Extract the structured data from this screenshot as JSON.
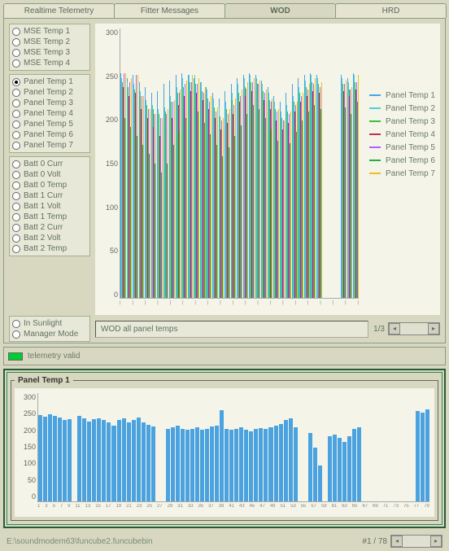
{
  "tabs": [
    {
      "label": "Realtime Telemetry",
      "active": false
    },
    {
      "label": "Fitter Messages",
      "active": false
    },
    {
      "label": "WOD",
      "active": true
    },
    {
      "label": "HRD",
      "active": false
    }
  ],
  "sidebar": {
    "group1": [
      {
        "label": "MSE Temp 1",
        "selected": false
      },
      {
        "label": "MSE Temp 2",
        "selected": false
      },
      {
        "label": "MSE Temp 3",
        "selected": false
      },
      {
        "label": "MSE Temp 4",
        "selected": false
      }
    ],
    "group2": [
      {
        "label": "Panel Temp 1",
        "selected": true
      },
      {
        "label": "Panel Temp 2",
        "selected": false
      },
      {
        "label": "Panel Temp 3",
        "selected": false
      },
      {
        "label": "Panel Temp 4",
        "selected": false
      },
      {
        "label": "Panel Temp 5",
        "selected": false
      },
      {
        "label": "Panel Temp 6",
        "selected": false
      },
      {
        "label": "Panel Temp 7",
        "selected": false
      }
    ],
    "group3": [
      {
        "label": "Batt 0 Curr",
        "selected": false
      },
      {
        "label": "Batt 0 Volt",
        "selected": false
      },
      {
        "label": "Batt 0 Temp",
        "selected": false
      },
      {
        "label": "Batt 1 Curr",
        "selected": false
      },
      {
        "label": "Batt 1 Volt",
        "selected": false
      },
      {
        "label": "Batt 1 Temp",
        "selected": false
      },
      {
        "label": "Batt 2 Curr",
        "selected": false
      },
      {
        "label": "Batt 2 Volt",
        "selected": false
      },
      {
        "label": "Batt 2 Temp",
        "selected": false
      }
    ],
    "group4": [
      {
        "label": "In Sunlight",
        "selected": false
      },
      {
        "label": "Manager Mode",
        "selected": false
      }
    ]
  },
  "chart_data": [
    {
      "type": "bar",
      "title": "",
      "ylim": [
        0,
        300
      ],
      "yticks": [
        0,
        50,
        100,
        150,
        200,
        250,
        300
      ],
      "series": [
        {
          "name": "Panel Temp 1",
          "color": "#4aa3e0"
        },
        {
          "name": "Panel Temp 2",
          "color": "#4ad0e0"
        },
        {
          "name": "Panel Temp 3",
          "color": "#3ac040"
        },
        {
          "name": "Panel Temp 4",
          "color": "#c03050"
        },
        {
          "name": "Panel Temp 5",
          "color": "#b060ff"
        },
        {
          "name": "Panel Temp 6",
          "color": "#20b040"
        },
        {
          "name": "Panel Temp 7",
          "color": "#e8c020"
        }
      ],
      "columns": [
        [
          250,
          245,
          240,
          235,
          250,
          200,
          250
        ],
        [
          245,
          240,
          235,
          225,
          240,
          190,
          245
        ],
        [
          248,
          238,
          232,
          228,
          248,
          180,
          248
        ],
        [
          240,
          230,
          225,
          210,
          225,
          170,
          225
        ],
        [
          235,
          220,
          215,
          200,
          210,
          160,
          210
        ],
        [
          228,
          215,
          210,
          190,
          205,
          150,
          205
        ],
        [
          230,
          210,
          205,
          180,
          200,
          140,
          200
        ],
        [
          238,
          212,
          208,
          185,
          205,
          150,
          210
        ],
        [
          242,
          225,
          218,
          200,
          218,
          170,
          220
        ],
        [
          248,
          235,
          228,
          215,
          228,
          185,
          232
        ],
        [
          250,
          245,
          235,
          225,
          238,
          200,
          242
        ],
        [
          248,
          248,
          240,
          230,
          240,
          210,
          248
        ],
        [
          245,
          248,
          238,
          228,
          238,
          208,
          245
        ],
        [
          240,
          240,
          230,
          220,
          228,
          195,
          235
        ],
        [
          235,
          232,
          222,
          210,
          218,
          182,
          225
        ],
        [
          228,
          222,
          212,
          200,
          208,
          170,
          212
        ],
        [
          222,
          212,
          202,
          188,
          198,
          158,
          200
        ],
        [
          230,
          218,
          210,
          195,
          205,
          168,
          210
        ],
        [
          238,
          228,
          220,
          205,
          215,
          180,
          222
        ],
        [
          245,
          238,
          228,
          218,
          225,
          192,
          232
        ],
        [
          248,
          245,
          235,
          225,
          233,
          205,
          240
        ],
        [
          250,
          248,
          240,
          230,
          240,
          215,
          245
        ],
        [
          248,
          245,
          238,
          228,
          238,
          210,
          242
        ],
        [
          242,
          238,
          230,
          220,
          228,
          200,
          232
        ],
        [
          235,
          228,
          220,
          210,
          218,
          188,
          222
        ],
        [
          225,
          218,
          210,
          198,
          208,
          175,
          210
        ],
        [
          218,
          208,
          200,
          188,
          198,
          162,
          198
        ],
        [
          228,
          215,
          208,
          195,
          205,
          172,
          208
        ],
        [
          238,
          225,
          218,
          208,
          215,
          185,
          218
        ],
        [
          245,
          235,
          228,
          218,
          225,
          198,
          228
        ],
        [
          248,
          242,
          235,
          225,
          232,
          208,
          238
        ],
        [
          250,
          248,
          240,
          230,
          238,
          215,
          245
        ],
        [
          248,
          245,
          238,
          228,
          235,
          210,
          240
        ],
        [
          0,
          0,
          0,
          0,
          0,
          0,
          0
        ],
        [
          0,
          0,
          0,
          0,
          0,
          0,
          0
        ],
        [
          0,
          0,
          0,
          0,
          0,
          0,
          0
        ],
        [
          248,
          245,
          238,
          230,
          238,
          212,
          242
        ],
        [
          245,
          240,
          232,
          225,
          232,
          205,
          235
        ],
        [
          250,
          248,
          240,
          232,
          240,
          218,
          248
        ]
      ]
    },
    {
      "type": "bar",
      "title": "Panel Temp 1",
      "ylim": [
        0,
        300
      ],
      "yticks": [
        0,
        50,
        100,
        150,
        200,
        250,
        300
      ],
      "color": "#4aa3e0",
      "values": [
        240,
        235,
        242,
        238,
        232,
        225,
        228,
        0,
        238,
        230,
        222,
        227,
        230,
        225,
        218,
        210,
        225,
        230,
        218,
        225,
        232,
        218,
        212,
        208,
        0,
        0,
        200,
        205,
        210,
        200,
        198,
        200,
        205,
        198,
        200,
        208,
        210,
        252,
        200,
        198,
        200,
        205,
        198,
        195,
        200,
        202,
        200,
        205,
        210,
        215,
        225,
        230,
        205,
        0,
        0,
        190,
        150,
        100,
        0,
        180,
        185,
        175,
        165,
        180,
        200,
        205,
        0,
        0,
        0,
        0,
        0,
        0,
        0,
        0,
        0,
        0,
        0,
        250,
        245,
        255
      ]
    }
  ],
  "footer": {
    "wod_label": "WOD all panel temps",
    "pager": "1/3"
  },
  "status": {
    "label": "telemetry valid"
  },
  "section2": {
    "title": "Panel Temp 1"
  },
  "page_footer": {
    "path": "E:\\soundmodem63\\funcube2.funcubebin",
    "pager": "#1 / 78"
  }
}
